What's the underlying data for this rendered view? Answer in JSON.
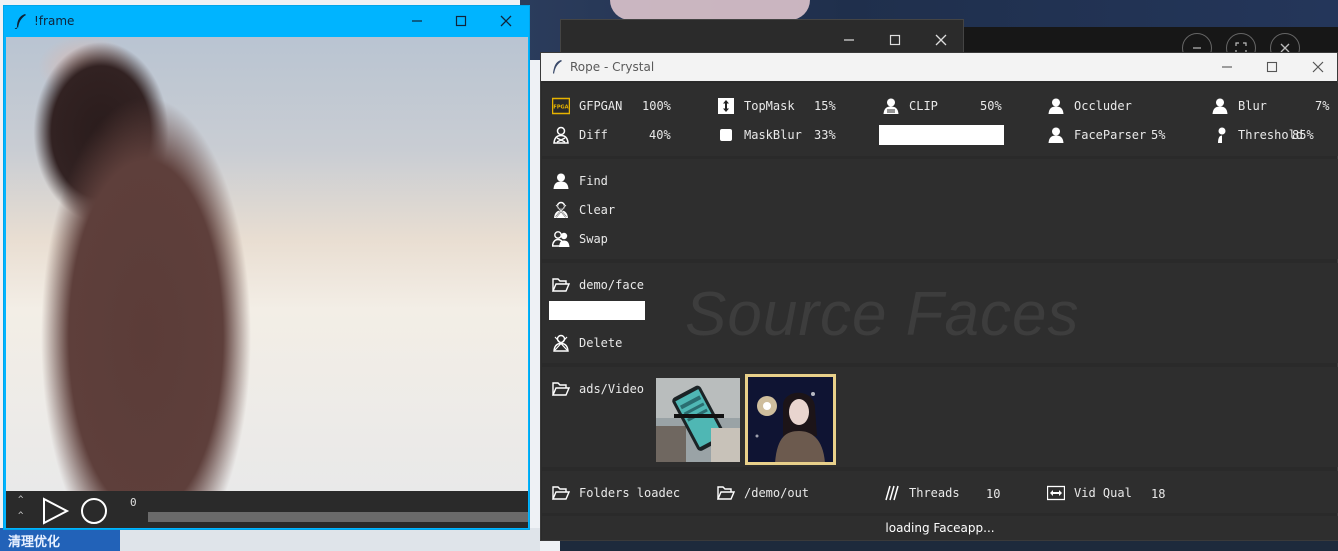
{
  "desktop": {
    "taskbar_item": "清理优化"
  },
  "frame_window": {
    "title": "!frame",
    "position_label": "0",
    "tick_up": "^",
    "tick_down": "^"
  },
  "rope_window": {
    "title": "Rope - Crystal",
    "params_row1": [
      {
        "label": "GFPGAN",
        "value": "100%",
        "icon": "gfpgan-icon"
      },
      {
        "label": "TopMask",
        "value": "15%",
        "icon": "vertical-arrows-icon"
      },
      {
        "label": "CLIP",
        "value": "50%",
        "icon": "clip-person-icon"
      },
      {
        "label": "Occluder",
        "value": "",
        "icon": "person-icon"
      },
      {
        "label": "Blur",
        "value": "7%",
        "icon": "person-icon"
      }
    ],
    "params_row2": [
      {
        "label": "Diff",
        "value": "40%",
        "icon": "diff-icon"
      },
      {
        "label": "MaskBlur",
        "value": "33%",
        "icon": "square-icon"
      },
      {
        "label": "FaceParser",
        "value": "5%",
        "icon": "person-icon"
      },
      {
        "label": "Threshold",
        "value": "85%",
        "icon": "threshold-icon"
      }
    ],
    "clip_text": "",
    "face_actions": [
      {
        "label": "Find",
        "icon": "person-icon"
      },
      {
        "label": "Clear",
        "icon": "clear-person-icon"
      },
      {
        "label": "Swap",
        "icon": "swap-person-icon"
      }
    ],
    "source_folder": "demo/face",
    "source_filter": "",
    "delete_label": "Delete",
    "source_watermark": "Source Faces",
    "video_folder": "ads/Video",
    "bottom_bar": {
      "folders_label": "Folders loadec",
      "output_folder": "/demo/out",
      "threads_label": "Threads",
      "threads_value": "10",
      "vidqual_label": "Vid Qual",
      "vidqual_value": "18"
    },
    "status": "loading Faceapp..."
  }
}
